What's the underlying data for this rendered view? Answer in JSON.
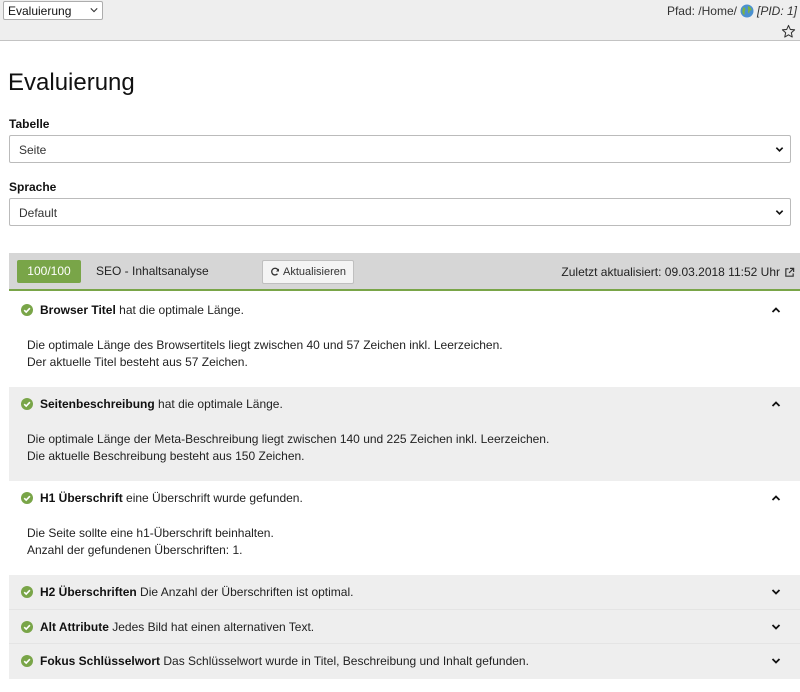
{
  "header": {
    "module_select": "Evaluierung",
    "path_label": "Pfad: /Home/",
    "pid": "[PID: 1]"
  },
  "page": {
    "title": "Evaluierung",
    "table_label": "Tabelle",
    "table_value": "Seite",
    "language_label": "Sprache",
    "language_value": "Default"
  },
  "panel": {
    "score": "100/100",
    "title": "SEO - Inhaltsanalyse",
    "refresh_label": "Aktualisieren",
    "updated": "Zuletzt aktualisiert: 09.03.2018 11:52 Uhr",
    "accent_color": "#79a548"
  },
  "items": [
    {
      "title": "Browser Titel",
      "summary": "hat die optimale Länge.",
      "expanded": true,
      "lines": [
        "Die optimale Länge des Browsertitels liegt zwischen 40 und 57 Zeichen inkl. Leerzeichen.",
        "Der aktuelle Titel besteht aus 57 Zeichen."
      ]
    },
    {
      "title": "Seitenbeschreibung",
      "summary": "hat die optimale Länge.",
      "expanded": true,
      "lines": [
        "Die optimale Länge der Meta-Beschreibung liegt zwischen 140 und 225 Zeichen inkl. Leerzeichen.",
        "Die aktuelle Beschreibung besteht aus 150 Zeichen."
      ]
    },
    {
      "title": "H1 Überschrift",
      "summary": "eine Überschrift wurde gefunden.",
      "expanded": true,
      "lines": [
        "Die Seite sollte eine h1-Überschrift beinhalten.",
        "Anzahl der gefundenen Überschriften: 1."
      ]
    },
    {
      "title": "H2 Überschriften",
      "summary": "Die Anzahl der Überschriften ist optimal.",
      "expanded": false
    },
    {
      "title": "Alt Attribute",
      "summary": "Jedes Bild hat einen alternativen Text.",
      "expanded": false
    },
    {
      "title": "Fokus Schlüsselwort",
      "summary": "Das Schlüsselwort wurde in Titel, Beschreibung und Inhalt gefunden.",
      "expanded": false
    }
  ]
}
